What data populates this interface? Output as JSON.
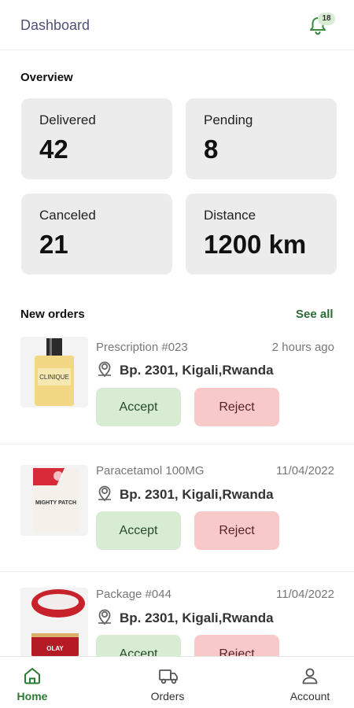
{
  "header": {
    "title": "Dashboard",
    "notification_count": "18"
  },
  "overview": {
    "title": "Overview",
    "stats": [
      {
        "label": "Delivered",
        "value": "42"
      },
      {
        "label": "Pending",
        "value": "8"
      },
      {
        "label": "Canceled",
        "value": "21"
      },
      {
        "label": "Distance",
        "value": "1200 km"
      }
    ]
  },
  "orders": {
    "title": "New orders",
    "see_all": "See all",
    "items": [
      {
        "name": "Prescription #023",
        "time": "2 hours ago",
        "address": "Bp. 2301, Kigali,Rwanda",
        "accept": "Accept",
        "reject": "Reject",
        "brand": "CLINIQUE"
      },
      {
        "name": "Paracetamol 100MG",
        "time": "11/04/2022",
        "address": "Bp. 2301, Kigali,Rwanda",
        "accept": "Accept",
        "reject": "Reject",
        "brand": "MIGHTY PATCH"
      },
      {
        "name": "Package #044",
        "time": "11/04/2022",
        "address": "Bp. 2301, Kigali,Rwanda",
        "accept": "Accept",
        "reject": "Reject",
        "brand": "OLAY"
      }
    ]
  },
  "tabs": [
    {
      "label": "Home",
      "icon": "home-icon",
      "active": true
    },
    {
      "label": "Orders",
      "icon": "truck-icon",
      "active": false
    },
    {
      "label": "Account",
      "icon": "user-icon",
      "active": false
    }
  ],
  "colors": {
    "accent": "#2d7a33",
    "accept_bg": "#d7ecd2",
    "reject_bg": "#f8c9c9",
    "card_bg": "#ececec"
  }
}
